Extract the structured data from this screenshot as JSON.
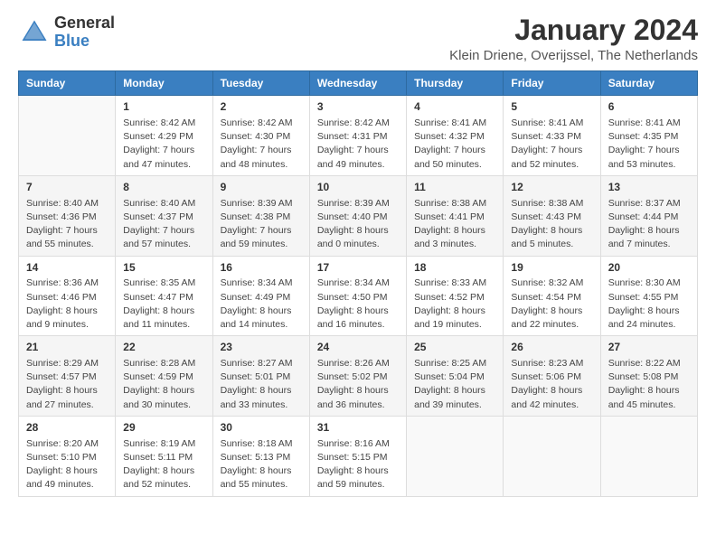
{
  "logo": {
    "line1": "General",
    "line2": "Blue"
  },
  "title": "January 2024",
  "subtitle": "Klein Driene, Overijssel, The Netherlands",
  "days_of_week": [
    "Sunday",
    "Monday",
    "Tuesday",
    "Wednesday",
    "Thursday",
    "Friday",
    "Saturday"
  ],
  "weeks": [
    [
      {
        "day": "",
        "empty": true
      },
      {
        "day": "1",
        "sunrise": "Sunrise: 8:42 AM",
        "sunset": "Sunset: 4:29 PM",
        "daylight": "Daylight: 7 hours and 47 minutes."
      },
      {
        "day": "2",
        "sunrise": "Sunrise: 8:42 AM",
        "sunset": "Sunset: 4:30 PM",
        "daylight": "Daylight: 7 hours and 48 minutes."
      },
      {
        "day": "3",
        "sunrise": "Sunrise: 8:42 AM",
        "sunset": "Sunset: 4:31 PM",
        "daylight": "Daylight: 7 hours and 49 minutes."
      },
      {
        "day": "4",
        "sunrise": "Sunrise: 8:41 AM",
        "sunset": "Sunset: 4:32 PM",
        "daylight": "Daylight: 7 hours and 50 minutes."
      },
      {
        "day": "5",
        "sunrise": "Sunrise: 8:41 AM",
        "sunset": "Sunset: 4:33 PM",
        "daylight": "Daylight: 7 hours and 52 minutes."
      },
      {
        "day": "6",
        "sunrise": "Sunrise: 8:41 AM",
        "sunset": "Sunset: 4:35 PM",
        "daylight": "Daylight: 7 hours and 53 minutes."
      }
    ],
    [
      {
        "day": "7",
        "sunrise": "Sunrise: 8:40 AM",
        "sunset": "Sunset: 4:36 PM",
        "daylight": "Daylight: 7 hours and 55 minutes."
      },
      {
        "day": "8",
        "sunrise": "Sunrise: 8:40 AM",
        "sunset": "Sunset: 4:37 PM",
        "daylight": "Daylight: 7 hours and 57 minutes."
      },
      {
        "day": "9",
        "sunrise": "Sunrise: 8:39 AM",
        "sunset": "Sunset: 4:38 PM",
        "daylight": "Daylight: 7 hours and 59 minutes."
      },
      {
        "day": "10",
        "sunrise": "Sunrise: 8:39 AM",
        "sunset": "Sunset: 4:40 PM",
        "daylight": "Daylight: 8 hours and 0 minutes."
      },
      {
        "day": "11",
        "sunrise": "Sunrise: 8:38 AM",
        "sunset": "Sunset: 4:41 PM",
        "daylight": "Daylight: 8 hours and 3 minutes."
      },
      {
        "day": "12",
        "sunrise": "Sunrise: 8:38 AM",
        "sunset": "Sunset: 4:43 PM",
        "daylight": "Daylight: 8 hours and 5 minutes."
      },
      {
        "day": "13",
        "sunrise": "Sunrise: 8:37 AM",
        "sunset": "Sunset: 4:44 PM",
        "daylight": "Daylight: 8 hours and 7 minutes."
      }
    ],
    [
      {
        "day": "14",
        "sunrise": "Sunrise: 8:36 AM",
        "sunset": "Sunset: 4:46 PM",
        "daylight": "Daylight: 8 hours and 9 minutes."
      },
      {
        "day": "15",
        "sunrise": "Sunrise: 8:35 AM",
        "sunset": "Sunset: 4:47 PM",
        "daylight": "Daylight: 8 hours and 11 minutes."
      },
      {
        "day": "16",
        "sunrise": "Sunrise: 8:34 AM",
        "sunset": "Sunset: 4:49 PM",
        "daylight": "Daylight: 8 hours and 14 minutes."
      },
      {
        "day": "17",
        "sunrise": "Sunrise: 8:34 AM",
        "sunset": "Sunset: 4:50 PM",
        "daylight": "Daylight: 8 hours and 16 minutes."
      },
      {
        "day": "18",
        "sunrise": "Sunrise: 8:33 AM",
        "sunset": "Sunset: 4:52 PM",
        "daylight": "Daylight: 8 hours and 19 minutes."
      },
      {
        "day": "19",
        "sunrise": "Sunrise: 8:32 AM",
        "sunset": "Sunset: 4:54 PM",
        "daylight": "Daylight: 8 hours and 22 minutes."
      },
      {
        "day": "20",
        "sunrise": "Sunrise: 8:30 AM",
        "sunset": "Sunset: 4:55 PM",
        "daylight": "Daylight: 8 hours and 24 minutes."
      }
    ],
    [
      {
        "day": "21",
        "sunrise": "Sunrise: 8:29 AM",
        "sunset": "Sunset: 4:57 PM",
        "daylight": "Daylight: 8 hours and 27 minutes."
      },
      {
        "day": "22",
        "sunrise": "Sunrise: 8:28 AM",
        "sunset": "Sunset: 4:59 PM",
        "daylight": "Daylight: 8 hours and 30 minutes."
      },
      {
        "day": "23",
        "sunrise": "Sunrise: 8:27 AM",
        "sunset": "Sunset: 5:01 PM",
        "daylight": "Daylight: 8 hours and 33 minutes."
      },
      {
        "day": "24",
        "sunrise": "Sunrise: 8:26 AM",
        "sunset": "Sunset: 5:02 PM",
        "daylight": "Daylight: 8 hours and 36 minutes."
      },
      {
        "day": "25",
        "sunrise": "Sunrise: 8:25 AM",
        "sunset": "Sunset: 5:04 PM",
        "daylight": "Daylight: 8 hours and 39 minutes."
      },
      {
        "day": "26",
        "sunrise": "Sunrise: 8:23 AM",
        "sunset": "Sunset: 5:06 PM",
        "daylight": "Daylight: 8 hours and 42 minutes."
      },
      {
        "day": "27",
        "sunrise": "Sunrise: 8:22 AM",
        "sunset": "Sunset: 5:08 PM",
        "daylight": "Daylight: 8 hours and 45 minutes."
      }
    ],
    [
      {
        "day": "28",
        "sunrise": "Sunrise: 8:20 AM",
        "sunset": "Sunset: 5:10 PM",
        "daylight": "Daylight: 8 hours and 49 minutes."
      },
      {
        "day": "29",
        "sunrise": "Sunrise: 8:19 AM",
        "sunset": "Sunset: 5:11 PM",
        "daylight": "Daylight: 8 hours and 52 minutes."
      },
      {
        "day": "30",
        "sunrise": "Sunrise: 8:18 AM",
        "sunset": "Sunset: 5:13 PM",
        "daylight": "Daylight: 8 hours and 55 minutes."
      },
      {
        "day": "31",
        "sunrise": "Sunrise: 8:16 AM",
        "sunset": "Sunset: 5:15 PM",
        "daylight": "Daylight: 8 hours and 59 minutes."
      },
      {
        "day": "",
        "empty": true
      },
      {
        "day": "",
        "empty": true
      },
      {
        "day": "",
        "empty": true
      }
    ]
  ]
}
